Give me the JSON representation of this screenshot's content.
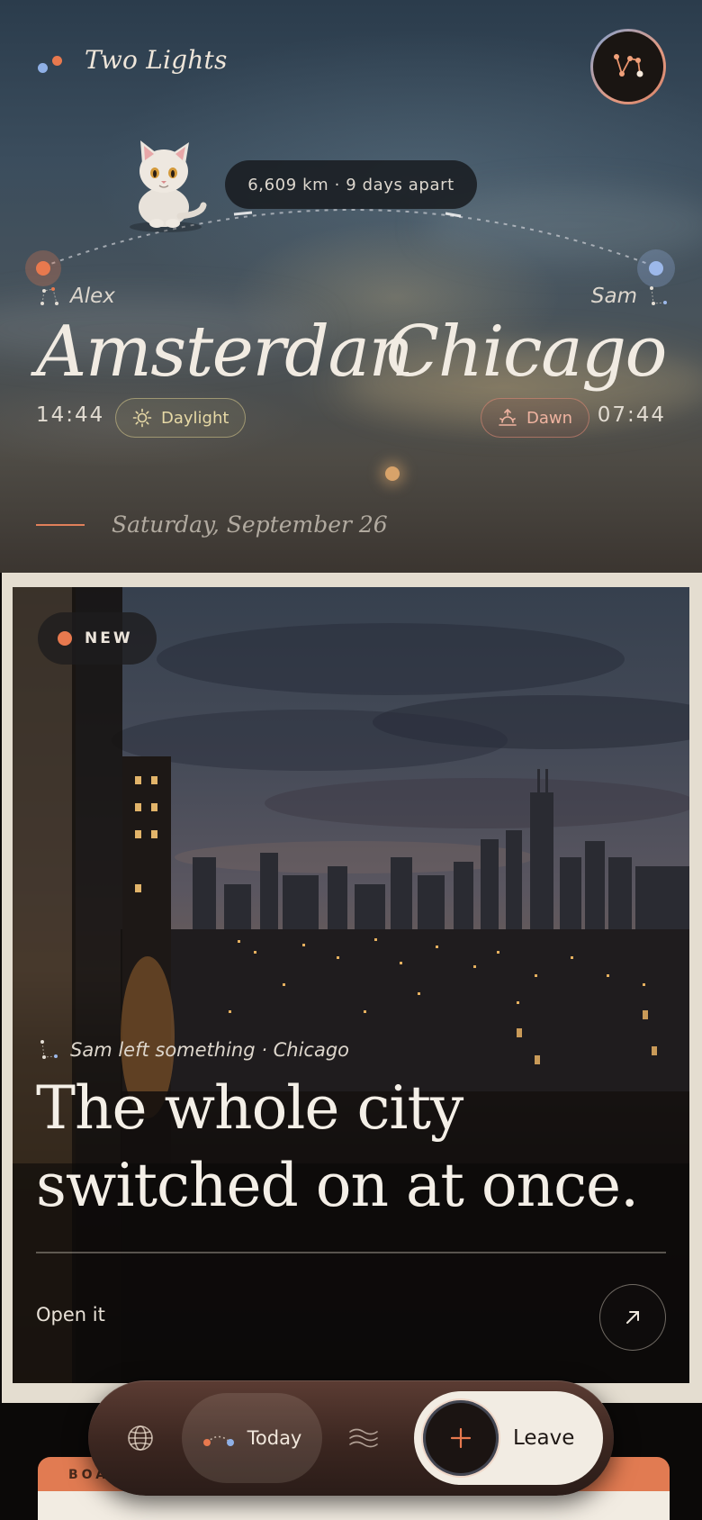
{
  "app": {
    "title": "Two Lights"
  },
  "header": {
    "distance": "6,609 km · 9 days apart"
  },
  "left_person": {
    "name": "Alex",
    "city": "Amsterdan",
    "time": "14:44",
    "status": "Daylight"
  },
  "right_person": {
    "name": "Sam",
    "city": "Chicago",
    "time": "07:44",
    "status": "Dawn"
  },
  "date": "Saturday, September 26",
  "card": {
    "badge": "NEW",
    "from": "Sam left something · Chicago",
    "headline_line1": "The whole city",
    "headline_line2": "switched on at once.",
    "cta": "Open it"
  },
  "peek_card": {
    "label": "BOA"
  },
  "tabbar": {
    "today_label": "Today",
    "leave_label": "Leave"
  },
  "colors": {
    "accent_orange": "#e8794e",
    "accent_blue": "#8fb0e6",
    "cream": "#f2ece3",
    "dark": "#1b1412"
  },
  "icons": [
    "constellation-icon",
    "cat-avatar",
    "sun-icon",
    "sunrise-icon",
    "arrow-up-right-icon",
    "globe-icon",
    "arc-icon",
    "waves-icon",
    "plus-icon"
  ]
}
